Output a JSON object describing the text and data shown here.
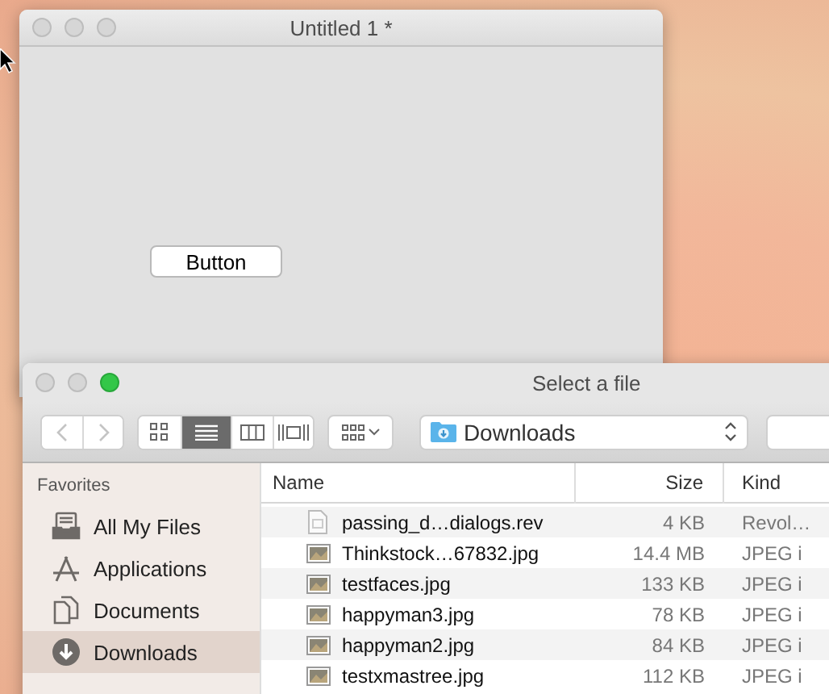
{
  "back_window": {
    "title": "Untitled 1 *",
    "button": "Button"
  },
  "dialog": {
    "title": "Select a file",
    "view_modes": [
      {
        "selected": false
      },
      {
        "selected": true
      },
      {
        "selected": false
      },
      {
        "selected": false
      }
    ],
    "location": "Downloads",
    "sidebar": {
      "heading": "Favorites",
      "items": [
        {
          "label": "All My Files",
          "selected": false
        },
        {
          "label": "Applications",
          "selected": false
        },
        {
          "label": "Documents",
          "selected": false
        },
        {
          "label": "Downloads",
          "selected": true
        }
      ]
    },
    "columns": [
      "Name",
      "Size",
      "Kind"
    ],
    "files": [
      {
        "kind": "document",
        "name": "passing_d…dialogs.rev",
        "size": "4 KB",
        "file_type": "Revol…"
      },
      {
        "kind": "image",
        "name": "Thinkstock…67832.jpg",
        "size": "14.4 MB",
        "file_type": "JPEG i"
      },
      {
        "kind": "image",
        "name": "testfaces.jpg",
        "size": "133 KB",
        "file_type": "JPEG i"
      },
      {
        "kind": "image",
        "name": "happyman3.jpg",
        "size": "78 KB",
        "file_type": "JPEG i"
      },
      {
        "kind": "image",
        "name": "happyman2.jpg",
        "size": "84 KB",
        "file_type": "JPEG i"
      },
      {
        "kind": "image",
        "name": "testxmastree.jpg",
        "size": "112 KB",
        "file_type": "JPEG i"
      }
    ]
  }
}
